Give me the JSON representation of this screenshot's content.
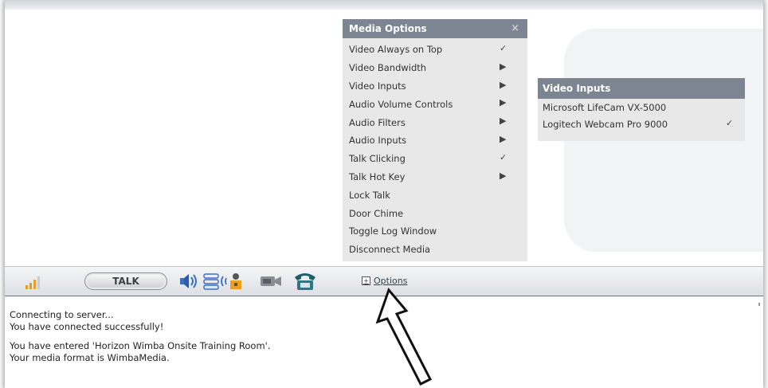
{
  "menu": {
    "title": "Media Options",
    "close_symbol": "×",
    "items": [
      {
        "label": "Video Always on Top",
        "mark": "✓"
      },
      {
        "label": "Video Bandwidth",
        "mark": "▶"
      },
      {
        "label": "Video Inputs",
        "mark": "▶"
      },
      {
        "label": "Audio Volume Controls",
        "mark": "▶"
      },
      {
        "label": "Audio Filters",
        "mark": "▶"
      },
      {
        "label": "Audio Inputs",
        "mark": "▶"
      },
      {
        "label": "Talk Clicking",
        "mark": "✓"
      },
      {
        "label": "Talk Hot Key",
        "mark": "▶"
      },
      {
        "label": "Lock Talk",
        "mark": ""
      },
      {
        "label": "Door Chime",
        "mark": ""
      },
      {
        "label": "Toggle Log Window",
        "mark": ""
      },
      {
        "label": "Disconnect Media",
        "mark": ""
      }
    ]
  },
  "submenu": {
    "title": "Video Inputs",
    "items": [
      {
        "label": "Microsoft LifeCam VX-5000",
        "mark": ""
      },
      {
        "label": "Logitech Webcam Pro 9000",
        "mark": "✓"
      }
    ]
  },
  "toolbar": {
    "talk_label": "TALK",
    "options_label": "Options",
    "options_box": "+",
    "icons": [
      "signal-icon",
      "speaker-icon",
      "equalizer-icon",
      "lock-person-icon",
      "camera-icon",
      "phone-icon"
    ]
  },
  "log": {
    "lines": [
      "Connecting to server...",
      "You have connected successfully!",
      "You have entered 'Horizon Wimba Onsite Training Room'.",
      "Your media format is WimbaMedia."
    ]
  },
  "colors": {
    "menu_header": "#7c8591",
    "menu_bg": "#e8e8e8",
    "signal": "#e89a1a"
  }
}
